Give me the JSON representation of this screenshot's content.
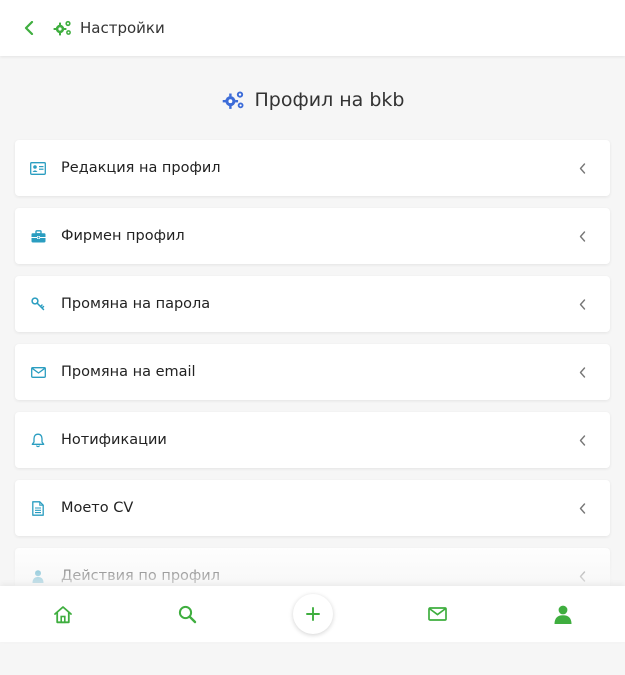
{
  "header": {
    "title": "Настройки"
  },
  "page": {
    "title": "Профил на bkb"
  },
  "menu": {
    "items": [
      {
        "label": "Редакция на профил",
        "icon": "id-card-icon"
      },
      {
        "label": "Фирмен профил",
        "icon": "briefcase-icon"
      },
      {
        "label": "Промяна на парола",
        "icon": "key-icon"
      },
      {
        "label": "Промяна на email",
        "icon": "envelope-icon"
      },
      {
        "label": "Нотификации",
        "icon": "bell-icon"
      },
      {
        "label": "Моето CV",
        "icon": "document-icon"
      },
      {
        "label": "Действия по профил",
        "icon": "user-icon"
      }
    ]
  },
  "bottom_nav": {
    "items": [
      "home-icon",
      "search-icon",
      "plus-icon",
      "envelope-icon",
      "user-icon"
    ]
  },
  "colors": {
    "green": "#3fae3f",
    "blue": "#3d6cd8",
    "teal": "#2a9dc0",
    "chevron": "#777777"
  }
}
